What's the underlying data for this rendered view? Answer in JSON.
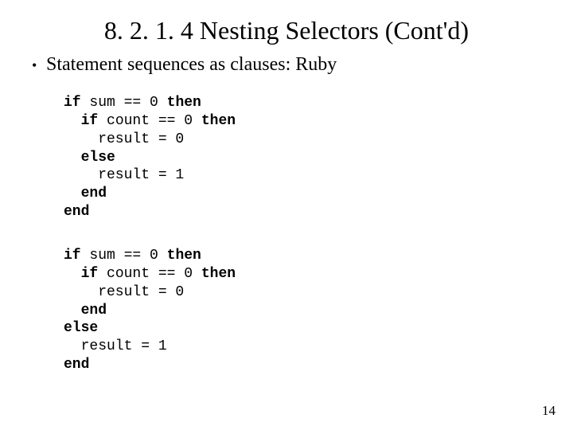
{
  "title": "8. 2. 1. 4 Nesting Selectors (Cont'd)",
  "bullet": "Statement sequences as clauses: Ruby",
  "code1": {
    "l1a": "if",
    "l1b": " sum == 0 ",
    "l1c": "then",
    "l2a": "  if",
    "l2b": " count == 0 ",
    "l2c": "then",
    "l3": "    result = 0",
    "l4": "  else",
    "l5": "    result = 1",
    "l6": "  end",
    "l7": "end"
  },
  "code2": {
    "l1a": "if",
    "l1b": " sum == 0 ",
    "l1c": "then",
    "l2a": "  if",
    "l2b": " count == 0 ",
    "l2c": "then",
    "l3": "    result = 0",
    "l4": "  end",
    "l5": "else",
    "l6": "  result = 1",
    "l7": "end"
  },
  "page_number": "14"
}
